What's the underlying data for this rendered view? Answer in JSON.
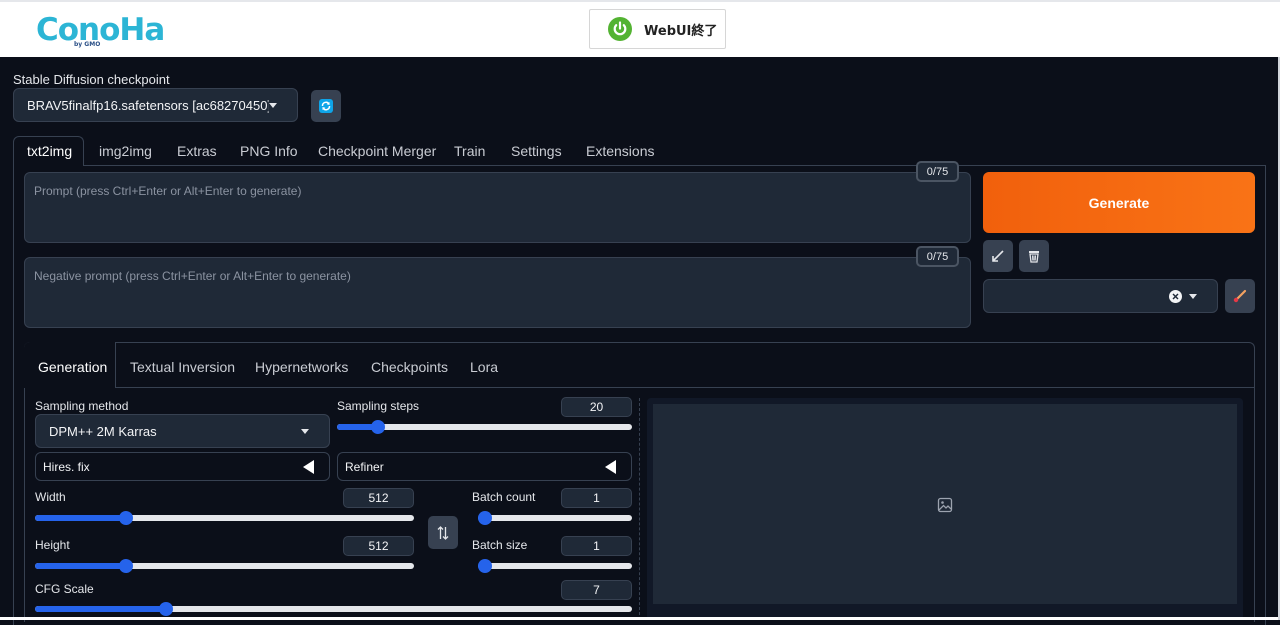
{
  "header": {
    "logo_text": "ConoHa",
    "logo_sub": "by GMO",
    "stop_button": "WebUI終了"
  },
  "checkpoint": {
    "label": "Stable Diffusion checkpoint",
    "value": "BRAV5finalfp16.safetensors [ac68270450]"
  },
  "main_tabs": [
    "txt2img",
    "img2img",
    "Extras",
    "PNG Info",
    "Checkpoint Merger",
    "Train",
    "Settings",
    "Extensions"
  ],
  "prompt": {
    "placeholder": "Prompt (press Ctrl+Enter or Alt+Enter to generate)",
    "counter": "0/75"
  },
  "negative_prompt": {
    "placeholder": "Negative prompt (press Ctrl+Enter or Alt+Enter to generate)",
    "counter": "0/75"
  },
  "generate_label": "Generate",
  "sub_tabs": [
    "Generation",
    "Textual Inversion",
    "Hypernetworks",
    "Checkpoints",
    "Lora"
  ],
  "sampling": {
    "method_label": "Sampling method",
    "method_value": "DPM++ 2M Karras",
    "steps_label": "Sampling steps",
    "steps_value": "20",
    "steps_fraction": 0.14
  },
  "hires_label": "Hires. fix",
  "refiner_label": "Refiner",
  "width": {
    "label": "Width",
    "value": "512",
    "fraction": 0.24
  },
  "height": {
    "label": "Height",
    "value": "512",
    "fraction": 0.24
  },
  "batch_count": {
    "label": "Batch count",
    "value": "1",
    "fraction": 0.0
  },
  "batch_size": {
    "label": "Batch size",
    "value": "1",
    "fraction": 0.0
  },
  "cfg": {
    "label": "CFG Scale",
    "value": "7",
    "fraction": 0.22
  },
  "colors": {
    "accent": "#2563eb",
    "generate": "#f97316",
    "background": "#0b0f19"
  },
  "icons": [
    "power-icon",
    "refresh-icon",
    "paste-icon",
    "trash-icon",
    "clear-icon",
    "paint-brush-icon",
    "swap-icon",
    "image-icon"
  ]
}
